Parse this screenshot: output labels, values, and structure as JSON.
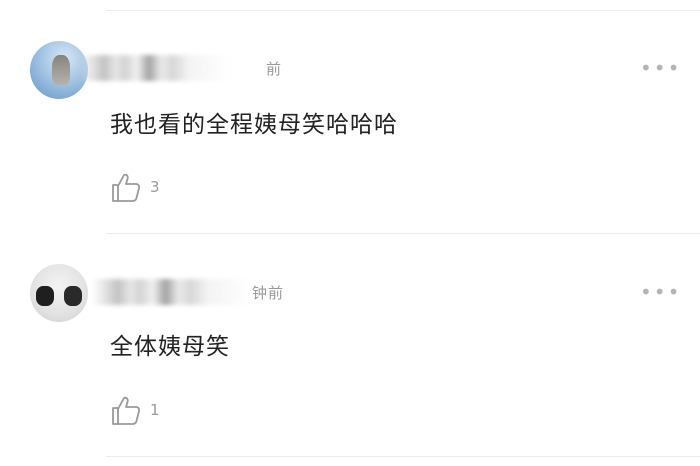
{
  "comments": [
    {
      "timestamp": "前",
      "more_label": "•••",
      "content": "我也看的全程姨母笑哈哈哈",
      "like_count": "3",
      "like_icon": "thumbs-up-outline-icon",
      "more_icon": "more-dots-icon"
    },
    {
      "timestamp": "钟前",
      "more_label": "•••",
      "content": "全体姨母笑",
      "like_count": "1",
      "like_icon": "thumbs-up-outline-icon",
      "more_icon": "more-dots-icon"
    }
  ]
}
